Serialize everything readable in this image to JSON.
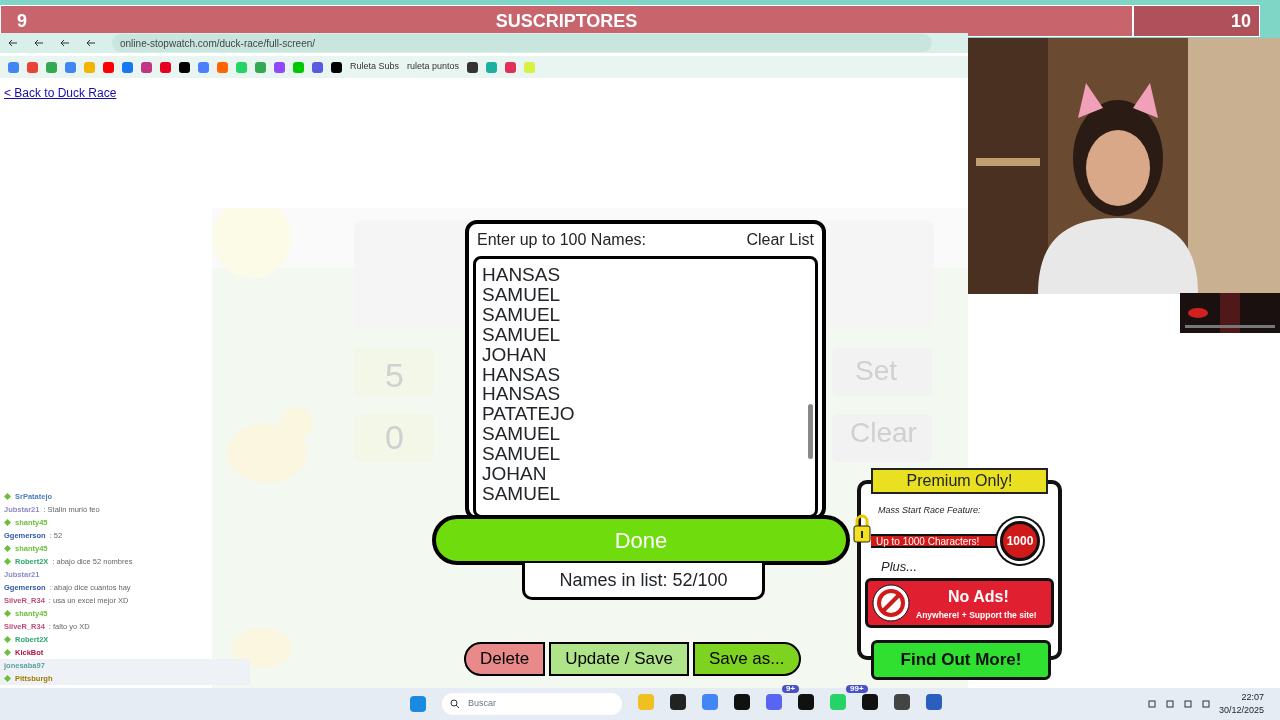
{
  "overlay_bar": {
    "left_count": "9",
    "title": "SUSCRIPTORES",
    "right_count": "10"
  },
  "browser": {
    "url": "online-stopwatch.com/duck-race/full-screen/",
    "bookmarks": [
      {
        "label": "Ruleta Subs"
      },
      {
        "label": "ruleta puntos"
      }
    ]
  },
  "page": {
    "back_link": "< Back to Duck Race",
    "faded_labels": [
      "5",
      "0",
      "Set",
      "Clear"
    ]
  },
  "names_dialog": {
    "title": "Enter up to 100 Names:",
    "clear_button": "Clear List",
    "names": [
      "HANSAS",
      "SAMUEL",
      "SAMUEL",
      "SAMUEL",
      "JOHAN",
      "HANSAS",
      "HANSAS",
      "PATATEJO",
      "SAMUEL",
      "SAMUEL",
      "JOHAN",
      "SAMUEL"
    ],
    "done_button": "Done",
    "count": "Names in list: 52/100"
  },
  "buttons": [
    {
      "label": "Delete",
      "kind": "danger"
    },
    {
      "label": "Update / Save",
      "kind": "light"
    },
    {
      "label": "Save as...",
      "kind": "success"
    }
  ],
  "premium": {
    "title": "Premium Only!",
    "feature": "Mass Start Race Feature:",
    "characters": "Up to 1000 Characters!",
    "limit": "1000",
    "plus": "Plus...",
    "no_ads": "No Ads!",
    "support": "Anywhere! + Support the site!",
    "cta": "Find Out More!"
  },
  "chat": [
    {
      "user": "SrPatatejo",
      "color": "#4a7fc0",
      "badge": true
    },
    {
      "user": "Jubstar21",
      "color": "#8a8ac8",
      "badge": false,
      "message": ": Stalin murió feo"
    },
    {
      "user": "shanty45",
      "color": "#6bbf3a",
      "badge": true
    },
    {
      "user": "Ggemerson",
      "color": "#2f5aa8",
      "badge": false,
      "message": ": 52"
    },
    {
      "user": "shanty45",
      "color": "#6bbf3a",
      "badge": true
    },
    {
      "user": "Robert2X",
      "color": "#2aa86a",
      "badge": true,
      "message": ": abajo dice 52 nombres"
    },
    {
      "user": "Jubstar21",
      "color": "#8a8ac8",
      "badge": false
    },
    {
      "user": "Ggemerson",
      "color": "#2f5aa8",
      "badge": false,
      "message": ": abajo dice cuantos hay"
    },
    {
      "user": "SilveR_R34",
      "color": "#c04a7a",
      "badge": false,
      "message": ": usa un excel mejor XD"
    },
    {
      "user": "shanty45",
      "color": "#6bbf3a",
      "badge": true
    },
    {
      "user": "SilveR_R34",
      "color": "#c04a7a",
      "badge": false,
      "message": ": falto yo XD"
    },
    {
      "user": "Robert2X",
      "color": "#2aa86a",
      "badge": true
    },
    {
      "user": "KickBot",
      "color": "#b0103a",
      "badge": true
    },
    {
      "user": "jonesaba97",
      "color": "#5aa0a0",
      "badge": false
    },
    {
      "user": "Pittsburgh",
      "color": "#a07c00",
      "badge": true
    }
  ],
  "taskbar": {
    "search_placeholder": "Buscar",
    "badges": [
      "9+",
      "99+"
    ],
    "time": "22:07",
    "date": "30/12/2025"
  }
}
